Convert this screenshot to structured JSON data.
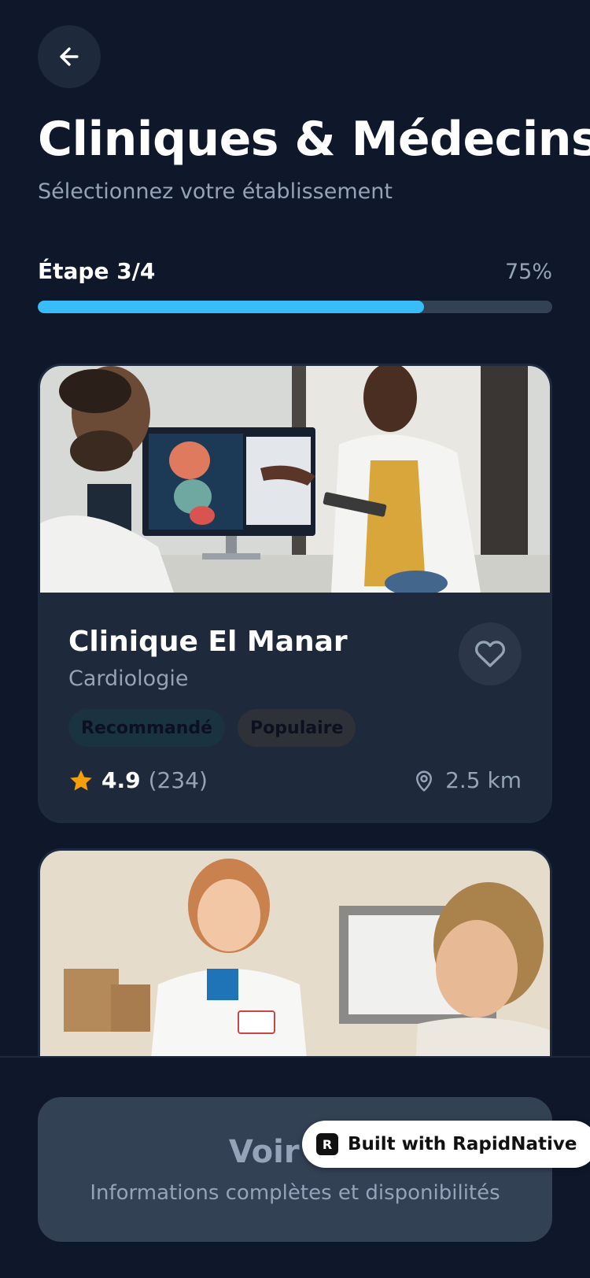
{
  "header": {
    "title": "Cliniques & Médecins",
    "subtitle": "Sélectionnez votre établissement"
  },
  "progress": {
    "step_label": "Étape 3/4",
    "percent_label": "75%",
    "value": 0.75
  },
  "cards": [
    {
      "name": "Clinique El Manar",
      "specialty": "Cardiologie",
      "tags": [
        "Recommandé",
        "Populaire"
      ],
      "rating": "4.9",
      "reviews": "(234)",
      "distance": "2.5 km",
      "favorite_icon": "heart-outline-icon"
    },
    {
      "image_alt": "doctor-with-patient-photo"
    }
  ],
  "cta": {
    "title": "Voir les",
    "subtitle": "Informations complètes et disponibilités"
  },
  "badge": {
    "label": "Built with RapidNative"
  },
  "colors": {
    "background": "#0f172a",
    "card": "#1e293b",
    "accent": "#38bdf8",
    "star": "#f59e0b",
    "muted_text": "#94a3b8"
  }
}
